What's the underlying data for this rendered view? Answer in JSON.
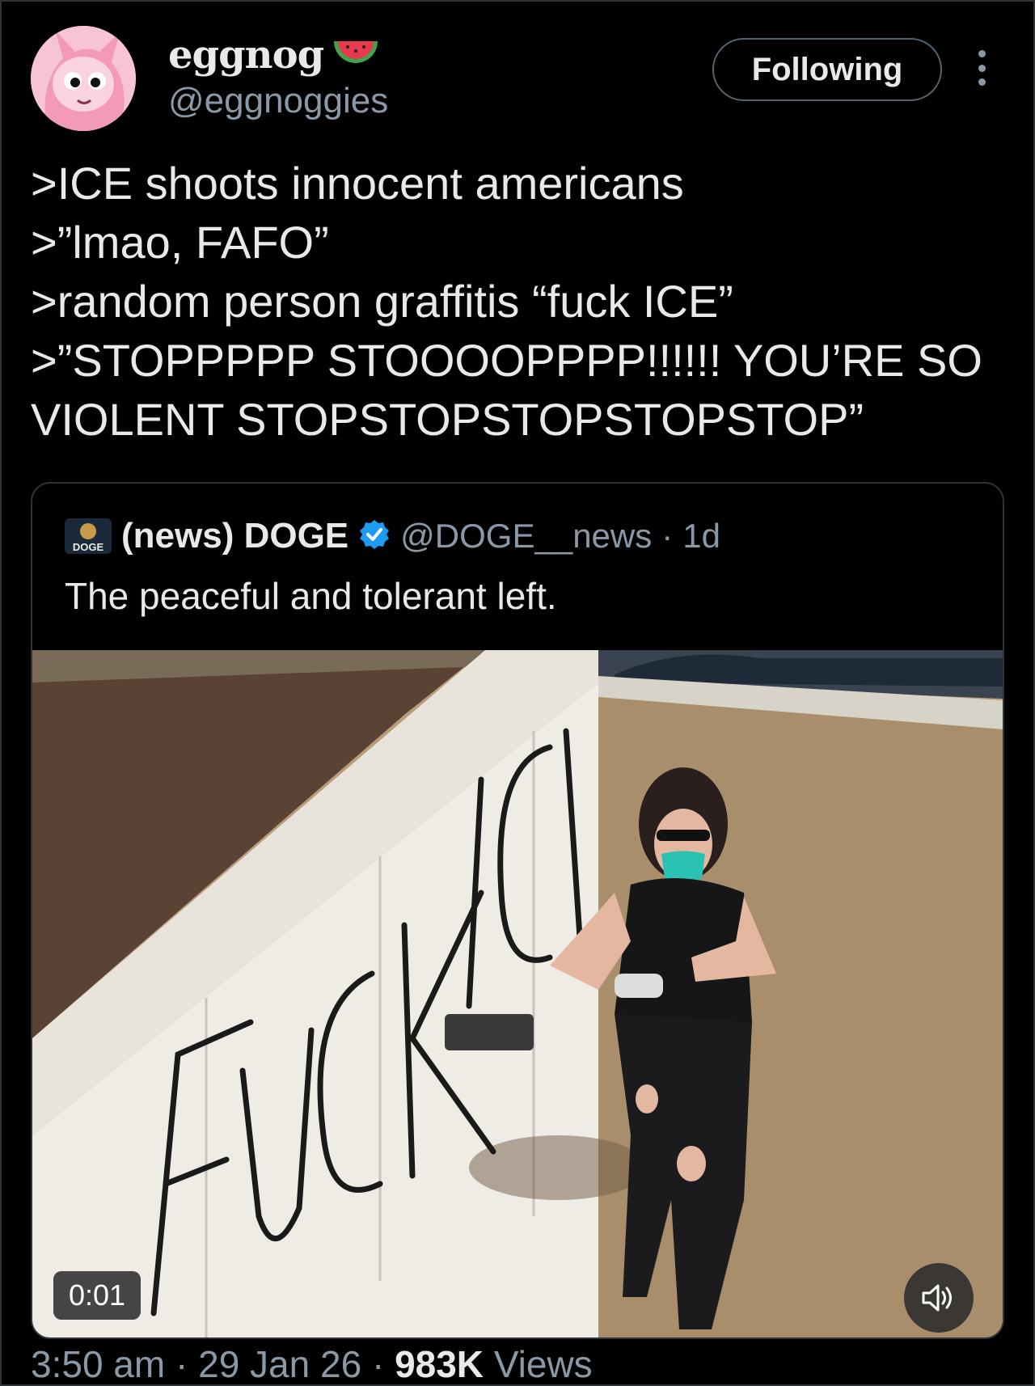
{
  "author": {
    "display_name": "eggnog",
    "name_emoji": "watermelon-icon",
    "handle": "@eggnoggies"
  },
  "follow_button": {
    "label": "Following"
  },
  "more_button": {
    "icon": "more-vertical-icon"
  },
  "tweet": {
    "lines": [
      ">ICE shoots innocent americans",
      ">”lmao, FAFO”",
      ">random person graffitis “fuck ICE”",
      ">”STOPPPPP STOOOOPPPP!!!!!! YOU’RE SO",
      "VIOLENT STOPSTOPSTOPSTOPSTOP”"
    ]
  },
  "quote": {
    "display_name": "(news) DOGE",
    "verified": true,
    "handle": "@DOGE__news",
    "separator": "·",
    "age": "1d",
    "text": "The peaceful and tolerant left.",
    "avatar_text": "DOGE",
    "video": {
      "time": "0:01",
      "graffiti_text": "FUCK ICE",
      "sound_icon": "volume-icon"
    }
  },
  "footer": {
    "time": "3:50 am",
    "sep1": "·",
    "date": "29 Jan 26",
    "sep2": "·",
    "views_count": "983K",
    "views_label": "Views"
  },
  "colors": {
    "background": "#000000",
    "text": "#e7e9ea",
    "muted": "#8b98a5",
    "border": "#2f3336",
    "verified": "#1d9bf0"
  }
}
